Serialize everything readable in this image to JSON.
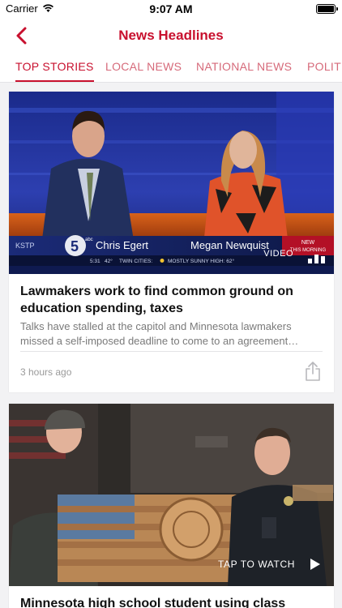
{
  "status_bar": {
    "carrier": "Carrier",
    "time": "9:07 AM"
  },
  "nav": {
    "title": "News Headlines"
  },
  "tabs": [
    {
      "label": "TOP STORIES",
      "active": true
    },
    {
      "label": "LOCAL NEWS",
      "active": false
    },
    {
      "label": "NATIONAL NEWS",
      "active": false
    },
    {
      "label": "POLITI",
      "active": false
    }
  ],
  "colors": {
    "accent": "#c8102e",
    "tab_inactive": "#d66a7a"
  },
  "stories": [
    {
      "headline": "Lawmakers work to find common ground on education spending, taxes",
      "summary": "Talks have stalled at the capitol and Minnesota lawmakers missed a self-imposed deadline to come to an agreement…",
      "time_ago": "3 hours ago",
      "media_label": "VIDEO",
      "media_icon": "video-bars-icon",
      "broadcast": {
        "station": "KSTP",
        "channel": "5",
        "network": "abc",
        "anchor_1": "Chris Egert",
        "anchor_2": "Megan Newquist",
        "badge_line_1": "NEW",
        "badge_line_2": "THIS MORNING",
        "ticker_time": "5:31",
        "ticker_temp": "42°",
        "ticker_city": "TWIN CITIES:",
        "ticker_forecast": "MOSTLY SUNNY HIGH: 62°"
      }
    },
    {
      "headline": "Minnesota high school student using class",
      "media_label": "TAP TO WATCH",
      "media_icon": "play-icon"
    }
  ]
}
